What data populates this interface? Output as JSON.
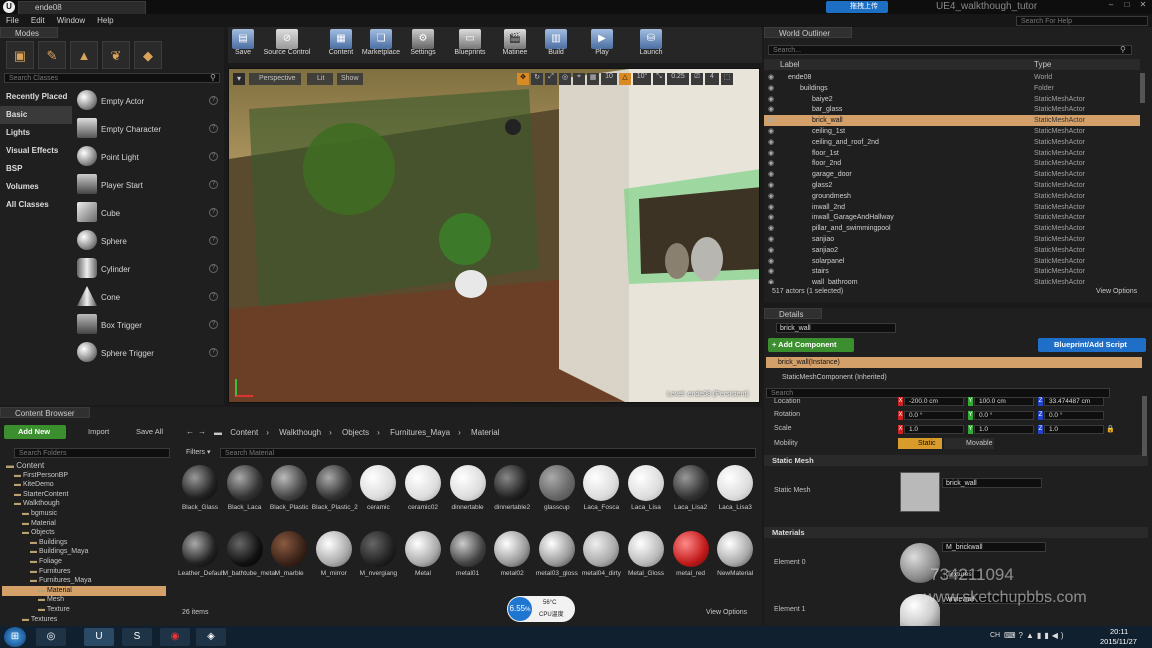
{
  "window": {
    "tab_title": "ende08",
    "app_title": "UE4_walkthough_tutor",
    "help_search_placeholder": "Search For Help",
    "upload_button": "拖拽上传"
  },
  "menu": [
    "File",
    "Edit",
    "Window",
    "Help"
  ],
  "modes": {
    "tab_label": "Modes",
    "search_placeholder": "Search Classes",
    "categories": [
      "Recently Placed",
      "Basic",
      "Lights",
      "Visual Effects",
      "BSP",
      "Volumes",
      "All Classes"
    ],
    "items": [
      "Empty Actor",
      "Empty Character",
      "Point Light",
      "Player Start",
      "Cube",
      "Sphere",
      "Cylinder",
      "Cone",
      "Box Trigger",
      "Sphere Trigger"
    ]
  },
  "toolbar": {
    "buttons": [
      "Save",
      "Source Control",
      "Content",
      "Marketplace",
      "Settings",
      "Blueprints",
      "Matinee",
      "Build",
      "Play",
      "Launch"
    ]
  },
  "viewport": {
    "perspective": "Perspective",
    "lit": "Lit",
    "show": "Show",
    "grid": "10",
    "angle": "10°",
    "scale": "0.25",
    "cam": "4",
    "level_label": "Level: ende08 (Persistent)"
  },
  "outliner": {
    "tab_label": "World Outliner",
    "search_placeholder": "Search...",
    "col_label": "Label",
    "col_type": "Type",
    "rows": [
      {
        "label": "ende08",
        "type": "World",
        "indent": 0
      },
      {
        "label": "buildings",
        "type": "Folder",
        "indent": 1
      },
      {
        "label": "baiye2",
        "type": "StaticMeshActor",
        "indent": 2
      },
      {
        "label": "bar_glass",
        "type": "StaticMeshActor",
        "indent": 2
      },
      {
        "label": "brick_wall",
        "type": "StaticMeshActor",
        "indent": 2
      },
      {
        "label": "ceiling_1st",
        "type": "StaticMeshActor",
        "indent": 2
      },
      {
        "label": "ceiling_and_roof_2nd",
        "type": "StaticMeshActor",
        "indent": 2
      },
      {
        "label": "floor_1st",
        "type": "StaticMeshActor",
        "indent": 2
      },
      {
        "label": "floor_2nd",
        "type": "StaticMeshActor",
        "indent": 2
      },
      {
        "label": "garage_door",
        "type": "StaticMeshActor",
        "indent": 2
      },
      {
        "label": "glass2",
        "type": "StaticMeshActor",
        "indent": 2
      },
      {
        "label": "groundmesh",
        "type": "StaticMeshActor",
        "indent": 2
      },
      {
        "label": "inwall_2nd",
        "type": "StaticMeshActor",
        "indent": 2
      },
      {
        "label": "inwall_GarageAndHallway",
        "type": "StaticMeshActor",
        "indent": 2
      },
      {
        "label": "pillar_and_swimmingpool",
        "type": "StaticMeshActor",
        "indent": 2
      },
      {
        "label": "sanjiao",
        "type": "StaticMeshActor",
        "indent": 2
      },
      {
        "label": "sanjiao2",
        "type": "StaticMeshActor",
        "indent": 2
      },
      {
        "label": "solarpanel",
        "type": "StaticMeshActor",
        "indent": 2
      },
      {
        "label": "stairs",
        "type": "StaticMeshActor",
        "indent": 2
      },
      {
        "label": "wall_bathroom",
        "type": "StaticMeshActor",
        "indent": 2
      }
    ],
    "selected_index": 4,
    "status": "517 actors (1 selected)",
    "view_options": "View Options"
  },
  "details": {
    "tab_label": "Details",
    "name_value": "brick_wall",
    "add_component": "+ Add Component",
    "blueprint_script": "Blueprint/Add Script",
    "components": [
      "brick_wall(Instance)",
      "StaticMeshComponent (Inherited)"
    ],
    "search_placeholder": "Search",
    "location_label": "Location",
    "location": [
      "-200.0 cm",
      "100.0 cm",
      "33.474487 cm"
    ],
    "rotation_label": "Rotation",
    "rotation": [
      "0.0 °",
      "0.0 °",
      "0.0 °"
    ],
    "scale_label": "Scale",
    "scale": [
      "1.0",
      "1.0",
      "1.0"
    ],
    "mobility_label": "Mobility",
    "mobility_static": "Static",
    "mobility_movable": "Movable",
    "static_mesh_section": "Static Mesh",
    "static_mesh_label": "Static Mesh",
    "static_mesh_value": "brick_wall",
    "materials_section": "Materials",
    "element0_label": "Element 0",
    "element0_value": "M_brickwall",
    "element0_textures": "Textures",
    "element1_label": "Element 1",
    "element1_value": "whitewall"
  },
  "content_browser": {
    "tab_label": "Content Browser",
    "add_new": "Add New",
    "import": "Import",
    "save_all": "Save All",
    "path": [
      "Content",
      "Walkthough",
      "Objects",
      "Furnitures_Maya",
      "Material"
    ],
    "folder_search_placeholder": "Search Folders",
    "filters": "Filters",
    "asset_search_placeholder": "Search Material",
    "tree": [
      {
        "label": "Content",
        "indent": 0
      },
      {
        "label": "FirstPersonBP",
        "indent": 1
      },
      {
        "label": "KiteDemo",
        "indent": 1
      },
      {
        "label": "StarterContent",
        "indent": 1
      },
      {
        "label": "Walkthough",
        "indent": 1
      },
      {
        "label": "bgmusic",
        "indent": 2
      },
      {
        "label": "Material",
        "indent": 2
      },
      {
        "label": "Objects",
        "indent": 2
      },
      {
        "label": "Buildings",
        "indent": 3
      },
      {
        "label": "Buildings_Maya",
        "indent": 3
      },
      {
        "label": "Foliage",
        "indent": 3
      },
      {
        "label": "Furnitures",
        "indent": 3
      },
      {
        "label": "Furnitures_Maya",
        "indent": 3
      },
      {
        "label": "Material",
        "indent": 4
      },
      {
        "label": "Mesh",
        "indent": 4
      },
      {
        "label": "Texture",
        "indent": 4
      },
      {
        "label": "Textures",
        "indent": 2
      }
    ],
    "assets_row1": [
      "Black_Glass",
      "Black_Laca",
      "Black_Plastic",
      "Black_Plastic_2",
      "ceramic",
      "ceramic02",
      "dinnertable",
      "dinnertable2",
      "glasscup",
      "Laca_Fosca",
      "Laca_Lisa",
      "Laca_Lisa2",
      "Laca_Lisa3"
    ],
    "assets_row2": [
      "Leather_Default",
      "M_bathtube_metal",
      "M_marble",
      "M_mirror",
      "M_nvergiang",
      "Metal",
      "metal01",
      "metal02",
      "metal03_gloss",
      "metal04_dirty",
      "Metal_Gloss",
      "metal_red",
      "NewMaterial"
    ],
    "count": "26 items",
    "view_options": "View Options"
  },
  "overlay": {
    "cpu_percent": "6.55",
    "cpu_percent_unit": "%",
    "cpu_temp": "56°C",
    "cpu_temp_label": "CPU温度",
    "watermark_number": "734211094",
    "watermark_site": "www.sketchupbbs.com"
  },
  "taskbar": {
    "time": "20:11",
    "date": "2015/11/27",
    "ime": "CH"
  }
}
